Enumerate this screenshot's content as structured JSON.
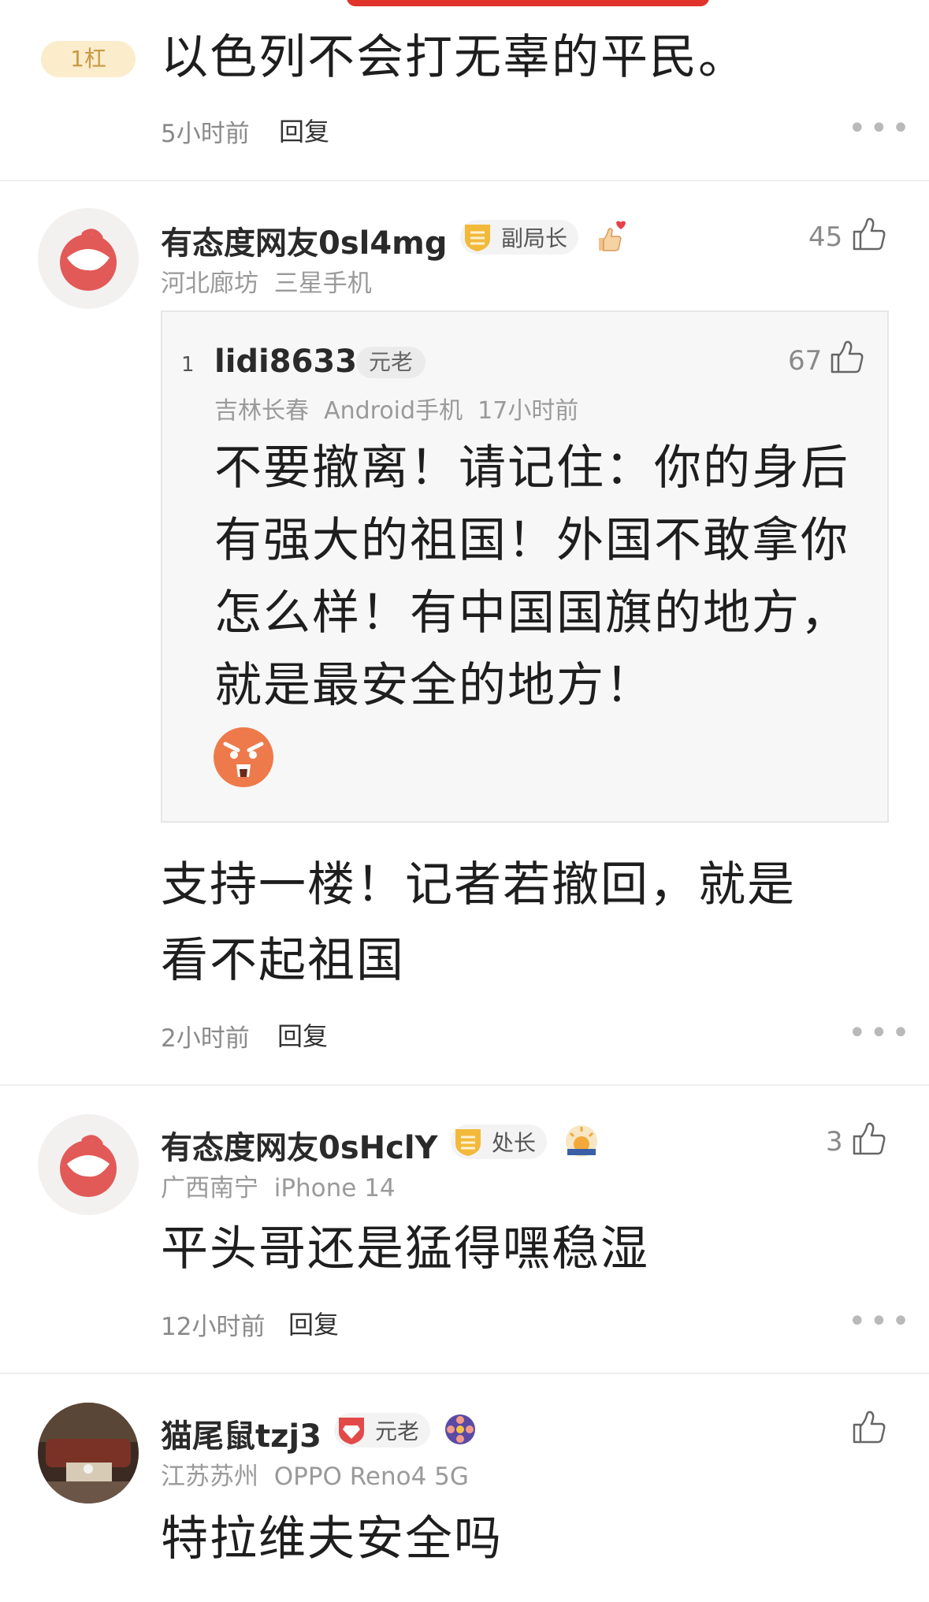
{
  "top_comment": {
    "floor_badge": "1杠",
    "text": "以色列不会打无辜的平民。",
    "time": "5小时前",
    "reply": "回复"
  },
  "comments": [
    {
      "username": "有态度网友0sl4mg",
      "rank": "副局长",
      "location": "河北廊坊",
      "device": "三星手机",
      "likes": "45",
      "quote": {
        "floor": "1",
        "username": "lidi8633",
        "rank": "元老",
        "location": "吉林长春",
        "device": "Android手机",
        "time": "17小时前",
        "likes": "67",
        "text": "不要撤离！请记住：你的身后有强大的祖国！外国不敢拿你怎么样！有中国国旗的地方，就是最安全的地方！"
      },
      "text_line1": "支持一楼！记者若撤回，就是",
      "text_line2": "看不起祖国",
      "time": "2小时前",
      "reply": "回复"
    },
    {
      "username": "有态度网友0sHclY",
      "rank": "处长",
      "location": "广西南宁",
      "device": "iPhone 14",
      "likes": "3",
      "text": "平头哥还是猛得嘿稳湿",
      "time": "12小时前",
      "reply": "回复"
    },
    {
      "username": "猫尾鼠tzj3",
      "rank": "元老",
      "location": "江苏苏州",
      "device": "OPPO Reno4 5G",
      "text": "特拉维夫安全吗"
    }
  ],
  "more_label": "•••",
  "colors": {
    "accent_red": "#e0332b",
    "badge_gold": "#c89a44",
    "muted": "#8a8a8a"
  },
  "icons": [
    "netease-avatar-icon",
    "shield-rank-icon",
    "thumbs-up-icon",
    "heart-hand-icon",
    "sunrise-icon",
    "film-reel-icon",
    "angry-face-emoji"
  ]
}
